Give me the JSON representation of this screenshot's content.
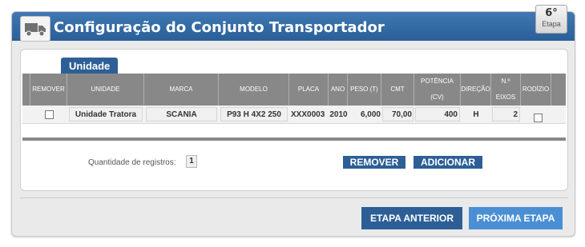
{
  "header": {
    "title": "Configuração do Conjunto Transportador",
    "stage_number": "6°",
    "stage_label": "Etapa"
  },
  "section": {
    "title": "Unidade"
  },
  "table": {
    "columns": [
      "REMOVER",
      "UNIDADE",
      "MARCA",
      "MODELO",
      "PLACA",
      "ANO",
      "PESO (T)",
      "CMT",
      "POTÊNCIA",
      "(CV)",
      "DIREÇÃO",
      "N.º",
      "EIXOS",
      "RODÍZIO"
    ],
    "rows": [
      {
        "remove_checked": false,
        "unidade": "Unidade Tratora",
        "marca": "SCANIA",
        "modelo": "P93 H 4X2 250",
        "placa": "XXX0003",
        "ano": "2010",
        "peso": "6,000",
        "cmt": "70,00",
        "potencia": "400",
        "direcao": "H",
        "eixos": "2",
        "rodizio_checked": false
      }
    ]
  },
  "footer": {
    "records_label": "Quantidade de registros:",
    "records_count": "1",
    "remove_label": "REMOVER",
    "add_label": "ADICIONAR"
  },
  "navigation": {
    "prev_label": "ETAPA ANTERIOR",
    "next_label": "PRÓXIMA ETAPA"
  },
  "colors": {
    "title_bar": "#2f6aa6",
    "button_primary": "#2d5f96",
    "button_next": "#4a8fd4",
    "table_header": "#888888"
  }
}
